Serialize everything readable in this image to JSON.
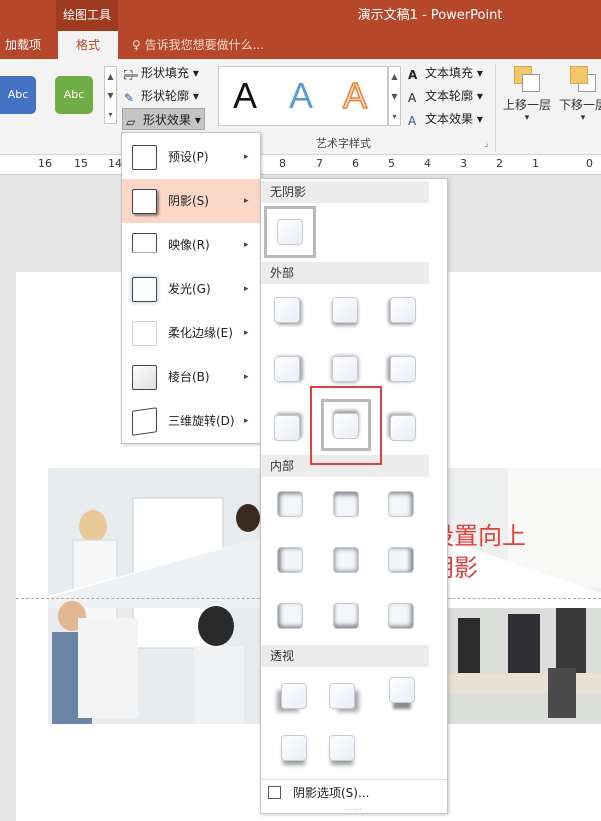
{
  "titlebar": {
    "tools_group": "绘图工具",
    "doc_title": "演示文稿1 - PowerPoint"
  },
  "tabs": [
    {
      "label": "加载项",
      "active": false
    },
    {
      "label": "格式",
      "active": true
    }
  ],
  "tell_me": "告诉我您想要做什么...",
  "ribbon": {
    "shape_styles": [
      {
        "label": "Abc",
        "color": "#4472c4"
      },
      {
        "label": "Abc",
        "color": "#70ad47"
      }
    ],
    "shape_fill": "形状填充",
    "shape_outline": "形状轮廓",
    "shape_effects": "形状效果",
    "wordart_letters": [
      "A",
      "A",
      "A"
    ],
    "wordart_colors": [
      "#111111",
      "#5b9bd5",
      "#ed7d31"
    ],
    "text_fill": "文本填充",
    "text_outline": "文本轮廓",
    "text_effects": "文本效果",
    "wordart_group_label": "艺术字样式",
    "bring_forward": "上移一层",
    "send_backward": "下移一层"
  },
  "ruler": {
    "numbers": [
      "16",
      "15",
      "14",
      "8",
      "7",
      "6",
      "5",
      "4",
      "3",
      "2",
      "1",
      "0"
    ]
  },
  "effects_menu": {
    "items": [
      {
        "label": "预设(P)",
        "highlighted": false
      },
      {
        "label": "阴影(S)",
        "highlighted": true
      },
      {
        "label": "映像(R)",
        "highlighted": false
      },
      {
        "label": "发光(G)",
        "highlighted": false
      },
      {
        "label": "柔化边缘(E)",
        "highlighted": false
      },
      {
        "label": "棱台(B)",
        "highlighted": false
      },
      {
        "label": "三维旋转(D)",
        "highlighted": false
      }
    ]
  },
  "shadow_menu": {
    "sections": [
      "无阴影",
      "外部",
      "内部",
      "透视"
    ],
    "selected": "外部 · 第3行第2列",
    "options_label": "阴影选项(S)..."
  },
  "annotation": {
    "line1": "设置向上",
    "line2": "阴影",
    "color": "#e1403c"
  }
}
